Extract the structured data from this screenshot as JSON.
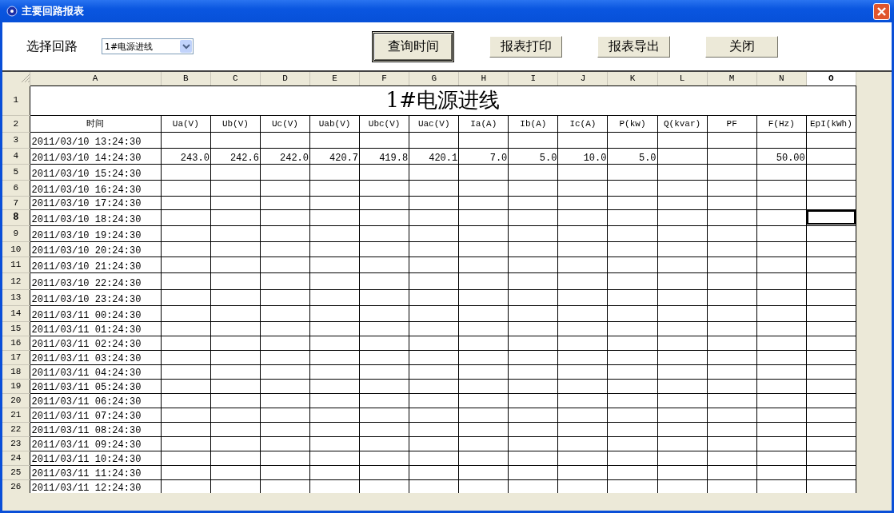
{
  "window": {
    "title": "主要回路报表"
  },
  "toolbar": {
    "label": "选择回路",
    "dropdown": {
      "value": "1#电源进线"
    },
    "buttons": [
      {
        "label": "查询时间",
        "focused": true
      },
      {
        "label": "报表打印",
        "focused": false
      },
      {
        "label": "报表导出",
        "focused": false
      },
      {
        "label": "关闭",
        "focused": false
      }
    ]
  },
  "sheet": {
    "columns": [
      {
        "label": "A",
        "selected": false
      },
      {
        "label": "B",
        "selected": false
      },
      {
        "label": "C",
        "selected": false
      },
      {
        "label": "D",
        "selected": false
      },
      {
        "label": "E",
        "selected": false
      },
      {
        "label": "F",
        "selected": false
      },
      {
        "label": "G",
        "selected": false
      },
      {
        "label": "H",
        "selected": false
      },
      {
        "label": "I",
        "selected": false
      },
      {
        "label": "J",
        "selected": false
      },
      {
        "label": "K",
        "selected": false
      },
      {
        "label": "L",
        "selected": false
      },
      {
        "label": "M",
        "selected": false
      },
      {
        "label": "N",
        "selected": false
      },
      {
        "label": "O",
        "selected": true
      }
    ],
    "rows": [
      {
        "number": "1",
        "selected": false,
        "kind": "title",
        "text": "1#电源进线"
      },
      {
        "number": "2",
        "selected": false,
        "kind": "header",
        "cells": [
          "时间",
          "Ua(V)",
          "Ub(V)",
          "Uc(V)",
          "Uab(V)",
          "Ubc(V)",
          "Uac(V)",
          "Ia(A)",
          "Ib(A)",
          "Ic(A)",
          "P(kw)",
          "Q(kvar)",
          "PF",
          "F(Hz)",
          "EpI(kWh)"
        ]
      },
      {
        "number": "3",
        "selected": false,
        "kind": "data",
        "cells": [
          "2011/03/10 13:24:30"
        ]
      },
      {
        "number": "4",
        "selected": false,
        "kind": "data",
        "cells": [
          "2011/03/10 14:24:30",
          "243.0",
          "242.6",
          "242.0",
          "420.7",
          "419.8",
          "420.1",
          "7.0",
          "5.0",
          "10.0",
          "5.0",
          null,
          null,
          "50.00"
        ]
      },
      {
        "number": "5",
        "selected": false,
        "kind": "data",
        "cells": [
          "2011/03/10 15:24:30"
        ]
      },
      {
        "number": "6",
        "selected": false,
        "kind": "data",
        "cells": [
          "2011/03/10 16:24:30"
        ]
      },
      {
        "number": "7",
        "selected": false,
        "kind": "data",
        "cells": [
          "2011/03/10 17:24:30"
        ]
      },
      {
        "number": "8",
        "selected": true,
        "kind": "data",
        "cells": [
          "2011/03/10 18:24:30"
        ]
      },
      {
        "number": "9",
        "selected": false,
        "kind": "data",
        "cells": [
          "2011/03/10 19:24:30"
        ]
      },
      {
        "number": "10",
        "selected": false,
        "kind": "data",
        "cells": [
          "2011/03/10 20:24:30"
        ]
      },
      {
        "number": "11",
        "selected": false,
        "kind": "data",
        "cells": [
          "2011/03/10 21:24:30"
        ]
      },
      {
        "number": "12",
        "selected": false,
        "kind": "data",
        "cells": [
          "2011/03/10 22:24:30"
        ]
      },
      {
        "number": "13",
        "selected": false,
        "kind": "data",
        "cells": [
          "2011/03/10 23:24:30"
        ]
      },
      {
        "number": "14",
        "selected": false,
        "kind": "data",
        "cells": [
          "2011/03/11 00:24:30"
        ]
      },
      {
        "number": "15",
        "selected": false,
        "kind": "data",
        "cells": [
          "2011/03/11 01:24:30"
        ]
      },
      {
        "number": "16",
        "selected": false,
        "kind": "data",
        "cells": [
          "2011/03/11 02:24:30"
        ]
      },
      {
        "number": "17",
        "selected": false,
        "kind": "data",
        "cells": [
          "2011/03/11 03:24:30"
        ]
      },
      {
        "number": "18",
        "selected": false,
        "kind": "data",
        "cells": [
          "2011/03/11 04:24:30"
        ]
      },
      {
        "number": "19",
        "selected": false,
        "kind": "data",
        "cells": [
          "2011/03/11 05:24:30"
        ]
      },
      {
        "number": "20",
        "selected": false,
        "kind": "data",
        "cells": [
          "2011/03/11 06:24:30"
        ]
      },
      {
        "number": "21",
        "selected": false,
        "kind": "data",
        "cells": [
          "2011/03/11 07:24:30"
        ]
      },
      {
        "number": "22",
        "selected": false,
        "kind": "data",
        "cells": [
          "2011/03/11 08:24:30"
        ]
      },
      {
        "number": "23",
        "selected": false,
        "kind": "data",
        "cells": [
          "2011/03/11 09:24:30"
        ]
      },
      {
        "number": "24",
        "selected": false,
        "kind": "data",
        "cells": [
          "2011/03/11 10:24:30"
        ]
      },
      {
        "number": "25",
        "selected": false,
        "kind": "data",
        "cells": [
          "2011/03/11 11:24:30"
        ]
      },
      {
        "number": "26",
        "selected": false,
        "kind": "data",
        "cells": [
          "2011/03/11 12:24:30"
        ]
      }
    ]
  }
}
